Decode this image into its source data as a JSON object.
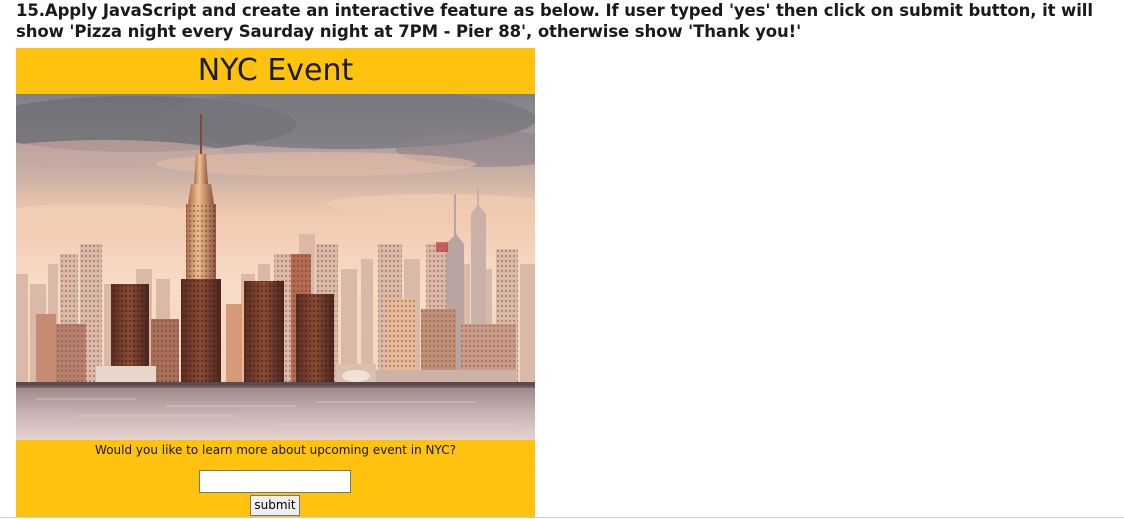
{
  "instructions": {
    "line1": "15.Apply JavaScript and create an interactive feature as below. If user typed 'yes' then click on submit button, it will",
    "line2": "show 'Pizza night every Saurday night at 7PM - Pier 88', otherwise show 'Thank you!'"
  },
  "card": {
    "title": "NYC Event",
    "image_subject": "New York City skyline at sunset with Empire State Building",
    "question": "Would you like to learn more about upcoming event in NYC?",
    "input_value": "",
    "submit_label": "submit",
    "background_color": "#ffc20e"
  }
}
